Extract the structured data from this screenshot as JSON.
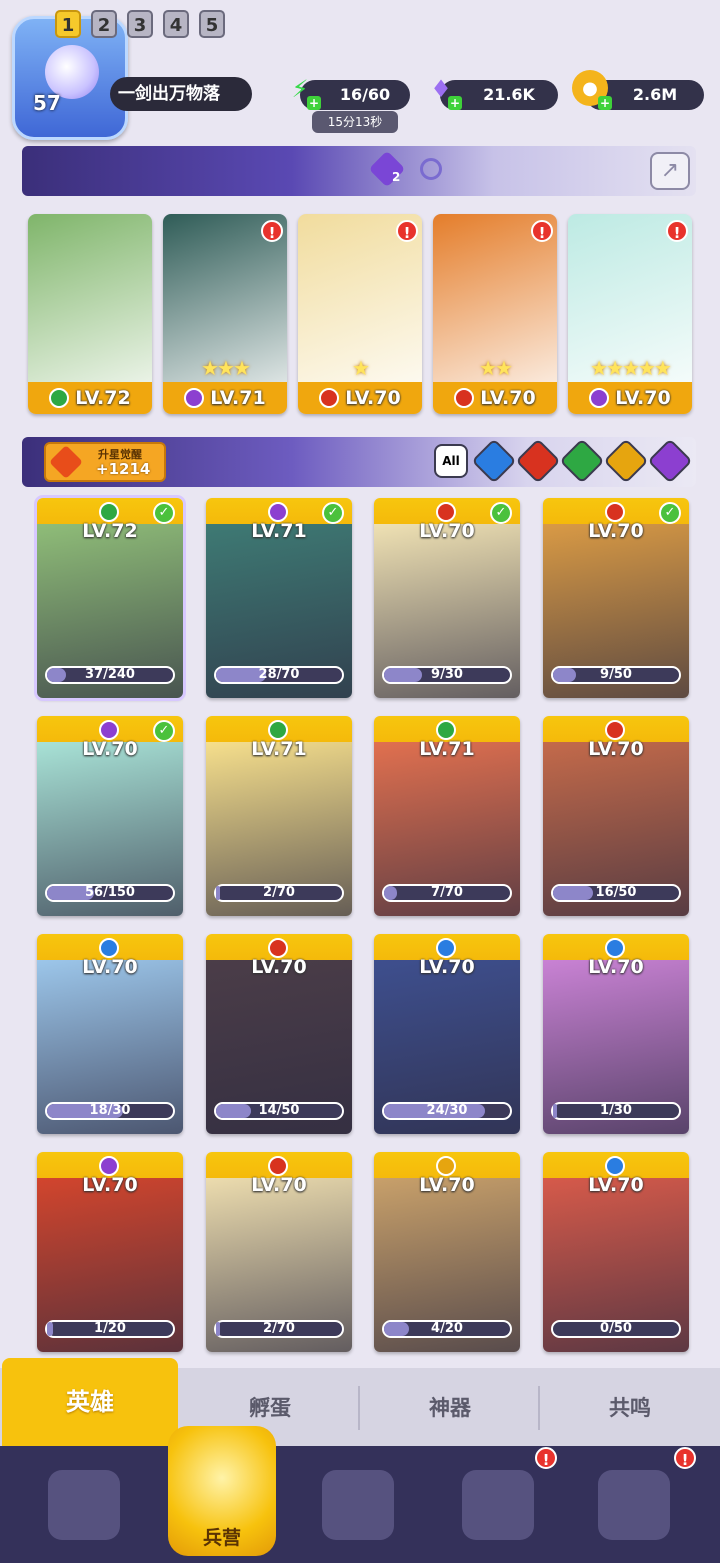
{
  "player": {
    "level": "57",
    "name": "一剑出万物落"
  },
  "resources": {
    "energy": {
      "icon": "lightning-icon",
      "value": "16/60",
      "timer": "15分13秒"
    },
    "gems": {
      "icon": "gem-icon",
      "value": "21.6K"
    },
    "gold": {
      "icon": "coin-icon",
      "value": "2.6M"
    }
  },
  "team_tabs": [
    "1",
    "2",
    "3",
    "4",
    "5"
  ],
  "team_badge": "2",
  "team": [
    {
      "level": "LV.72",
      "element": "leaf",
      "color": "#2ea843",
      "stars": "",
      "alert": false,
      "art": "#7fb56a"
    },
    {
      "level": "LV.71",
      "element": "moon",
      "color": "#8c3fd0",
      "stars": "★★★",
      "alert": true,
      "art": "#2f5c57"
    },
    {
      "level": "LV.70",
      "element": "fire",
      "color": "#d8321f",
      "stars": "★",
      "alert": true,
      "art": "#f1dc9d"
    },
    {
      "level": "LV.70",
      "element": "fire",
      "color": "#d8321f",
      "stars": "★★",
      "alert": true,
      "art": "#e47d2a"
    },
    {
      "level": "LV.70",
      "element": "moon",
      "color": "#8c3fd0",
      "stars": "★★★★★",
      "alert": true,
      "art": "#bdeae3"
    }
  ],
  "awaken": {
    "label": "升星觉醒",
    "value": "+1214"
  },
  "filters": [
    "All",
    "water",
    "fire",
    "leaf",
    "light",
    "moon"
  ],
  "heroes": [
    {
      "level": "LV.72",
      "element_color": "#2ea843",
      "progress": "37/240",
      "fill": 0.15,
      "checked": true,
      "art": "#8fbd78"
    },
    {
      "level": "LV.71",
      "element_color": "#8c3fd0",
      "progress": "28/70",
      "fill": 0.4,
      "checked": true,
      "art": "#3e7a74"
    },
    {
      "level": "LV.70",
      "element_color": "#d8321f",
      "progress": "9/30",
      "fill": 0.3,
      "checked": true,
      "art": "#efe1b3"
    },
    {
      "level": "LV.70",
      "element_color": "#d8321f",
      "progress": "9/50",
      "fill": 0.18,
      "checked": true,
      "art": "#d99a45"
    },
    {
      "level": "LV.70",
      "element_color": "#8c3fd0",
      "progress": "56/150",
      "fill": 0.37,
      "checked": true,
      "art": "#a8e2d6"
    },
    {
      "level": "LV.71",
      "element_color": "#2ea843",
      "progress": "2/70",
      "fill": 0.03,
      "checked": false,
      "art": "#f6df8c"
    },
    {
      "level": "LV.71",
      "element_color": "#2ea843",
      "progress": "7/70",
      "fill": 0.1,
      "checked": false,
      "art": "#e1704f"
    },
    {
      "level": "LV.70",
      "element_color": "#d8321f",
      "progress": "16/50",
      "fill": 0.32,
      "checked": false,
      "art": "#c46a4a"
    },
    {
      "level": "LV.70",
      "element_color": "#2a7de1",
      "progress": "18/30",
      "fill": 0.6,
      "checked": false,
      "art": "#9cc6ea"
    },
    {
      "level": "LV.70",
      "element_color": "#d8321f",
      "progress": "14/50",
      "fill": 0.28,
      "checked": false,
      "art": "#4b3d48"
    },
    {
      "level": "LV.70",
      "element_color": "#2a7de1",
      "progress": "24/30",
      "fill": 0.8,
      "checked": false,
      "art": "#3e4f8e"
    },
    {
      "level": "LV.70",
      "element_color": "#2a7de1",
      "progress": "1/30",
      "fill": 0.03,
      "checked": false,
      "art": "#c982d4"
    },
    {
      "level": "LV.70",
      "element_color": "#8c3fd0",
      "progress": "1/20",
      "fill": 0.05,
      "checked": false,
      "art": "#d2452d"
    },
    {
      "level": "LV.70",
      "element_color": "#d8321f",
      "progress": "2/70",
      "fill": 0.03,
      "checked": false,
      "art": "#ecdcae"
    },
    {
      "level": "LV.70",
      "element_color": "#e6a50f",
      "progress": "4/20",
      "fill": 0.2,
      "checked": false,
      "art": "#c8a06a"
    },
    {
      "level": "LV.70",
      "element_color": "#2a7de1",
      "progress": "0/50",
      "fill": 0.0,
      "checked": false,
      "art": "#d65a4a"
    }
  ],
  "tabs": [
    "英雄",
    "孵蛋",
    "神器",
    "共鸣"
  ],
  "nav": {
    "active_label": "兵营"
  }
}
